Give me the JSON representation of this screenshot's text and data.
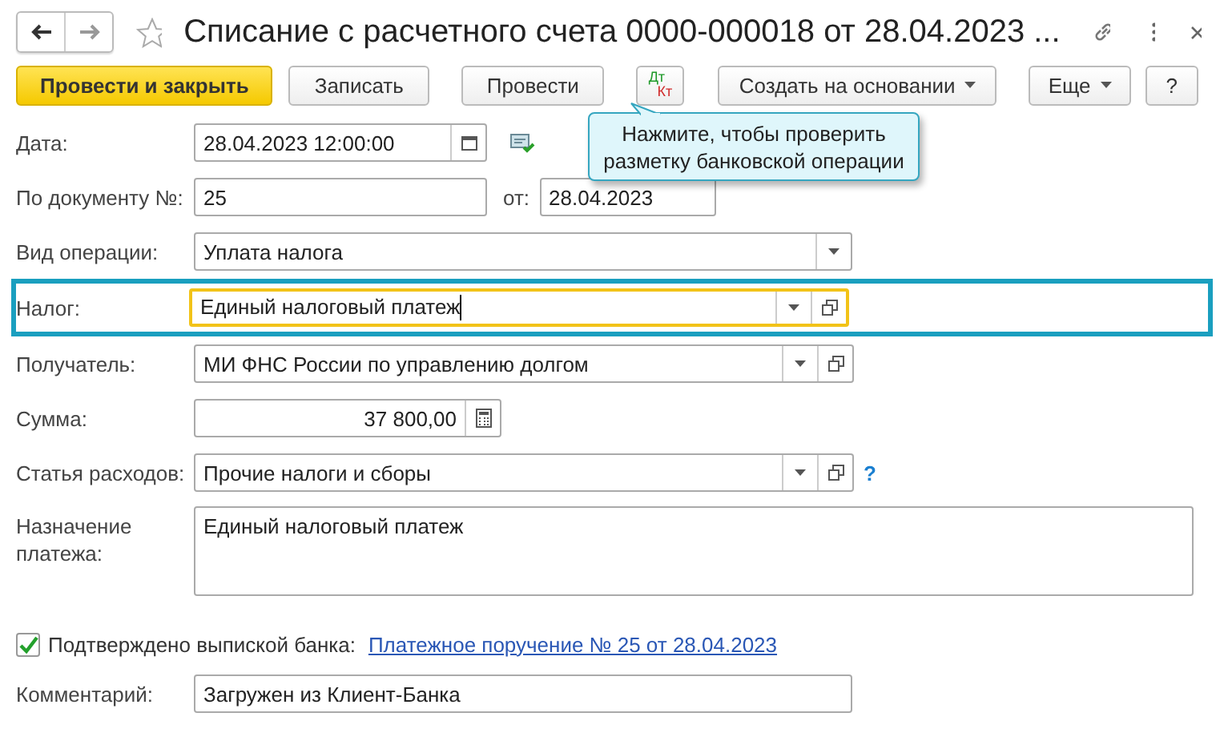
{
  "window": {
    "title": "Списание с расчетного счета 0000-000018 от 28.04.2023 ..."
  },
  "toolbar": [
    {
      "kind": "primary",
      "label": "Провести и закрыть"
    },
    {
      "kind": "button",
      "label": "Записать"
    },
    {
      "kind": "button",
      "label": "Провести"
    },
    {
      "kind": "dtkt",
      "label": "Дт",
      "label2": "Кт"
    },
    {
      "kind": "dropdown",
      "label": "Создать на основании"
    }
  ],
  "toolbar_right": [
    {
      "kind": "dropdown",
      "label": "Еще"
    },
    {
      "kind": "button",
      "label": "?"
    }
  ],
  "tooltip": "Нажмите, чтобы проверить разметку банковской операции",
  "fields": [
    {
      "kind": "date",
      "label": "Дата:",
      "value": "28.04.2023 12:00:00"
    },
    {
      "kind": "number",
      "label": "По документу №:",
      "value": "25",
      "label2": "от:",
      "value2": "28.04.2023"
    },
    {
      "kind": "select",
      "label": "Вид операции:",
      "value": "Уплата налога",
      "open": false,
      "highlighted": false,
      "focused": false
    },
    {
      "kind": "select",
      "label": "Налог:",
      "value": "Единый налоговый платеж",
      "open": true,
      "highlighted": true,
      "focused": true
    },
    {
      "kind": "select",
      "label": "Получатель:",
      "value": "МИ ФНС России по управлению долгом",
      "open": true,
      "highlighted": false,
      "focused": false
    },
    {
      "kind": "amount",
      "label": "Сумма:",
      "value": "37 800,00"
    },
    {
      "kind": "select",
      "label": "Статья расходов:",
      "value": "Прочие налоги и сборы",
      "open": true,
      "highlighted": false,
      "focused": false,
      "help": true,
      "help_text": "?"
    },
    {
      "kind": "textarea",
      "label": "Назначение платежа:",
      "value": "Единый налоговый платеж"
    },
    {
      "kind": "checkbox",
      "label": "Подтверждено выпиской банка:",
      "checked": true,
      "link": "Платежное поручение № 25 от 28.04.2023"
    },
    {
      "kind": "text",
      "label": "Комментарий:",
      "value": "Загружен из Клиент-Банка"
    }
  ]
}
